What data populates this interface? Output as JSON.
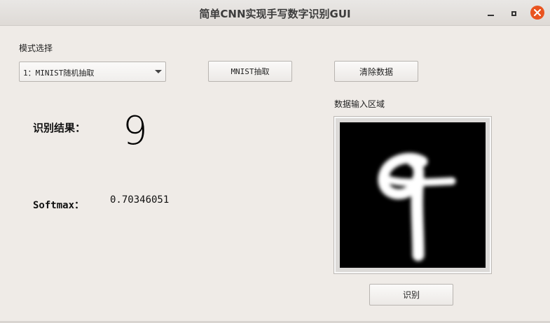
{
  "window": {
    "title": "简单CNN实现手写数字识别GUI"
  },
  "mode": {
    "label": "模式选择",
    "selected": "1：MINIST随机抽取"
  },
  "buttons": {
    "mnist_sample": "MNIST抽取",
    "clear_data": "清除数据",
    "recognize": "识别"
  },
  "result": {
    "label": "识别结果：",
    "value": "9",
    "softmax_label": "Softmax：",
    "softmax_value": "0.70346051"
  },
  "input_area": {
    "label": "数据输入区域",
    "digit_drawn": "9"
  },
  "colors": {
    "close_button": "#e95420",
    "canvas_background": "#000000",
    "stroke": "#ffffff"
  },
  "icons": [
    "minimize-icon",
    "maximize-icon",
    "close-icon",
    "chevron-down-icon"
  ]
}
